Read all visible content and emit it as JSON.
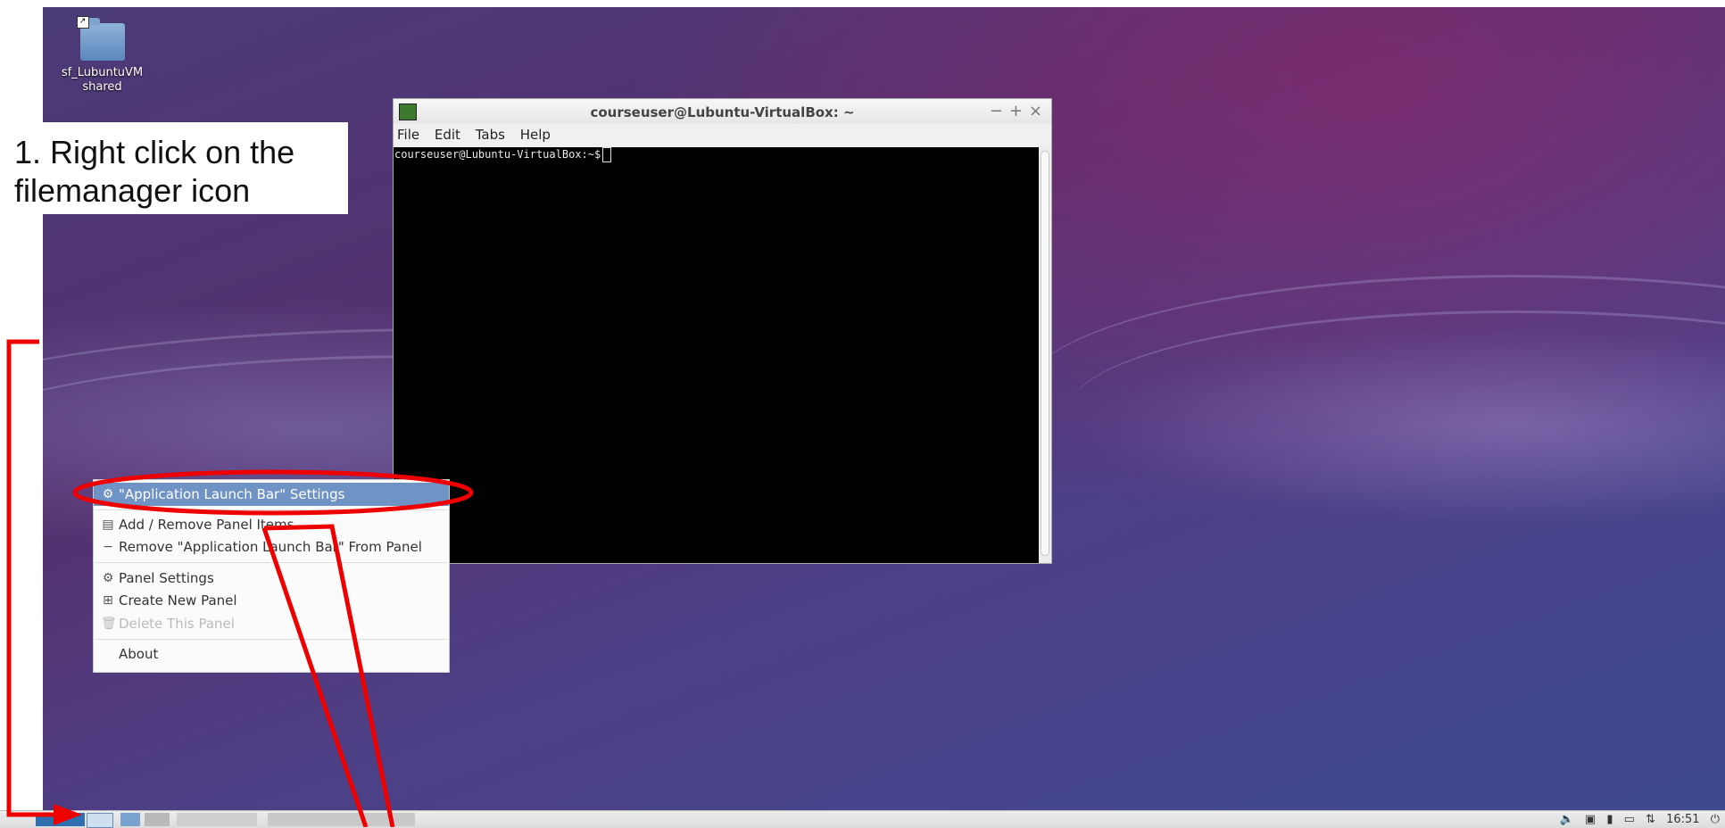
{
  "desktop": {
    "icon_label_line1": "sf_LubuntuVM",
    "icon_label_line2": "shared"
  },
  "annotation": {
    "line1": "1. Right click on the",
    "line2": "filemanager icon"
  },
  "terminal": {
    "title": "courseuser@Lubuntu-VirtualBox: ~",
    "controls": {
      "minimize": "−",
      "maximize": "+",
      "close": "×"
    },
    "menu": [
      "File",
      "Edit",
      "Tabs",
      "Help"
    ],
    "prompt": "courseuser@Lubuntu-VirtualBox:~$"
  },
  "context_menu": {
    "items": [
      {
        "label": "\"Application Launch Bar\" Settings",
        "icon": "gear-icon",
        "highlighted": true,
        "disabled": false
      },
      {
        "label": "Add / Remove Panel Items",
        "icon": "list-icon",
        "highlighted": false,
        "disabled": false
      },
      {
        "label": "Remove \"Application Launch Bar\" From Panel",
        "icon": "minus-icon",
        "highlighted": false,
        "disabled": false
      },
      {
        "label": "Panel Settings",
        "icon": "gear-icon",
        "highlighted": false,
        "disabled": false
      },
      {
        "label": "Create New Panel",
        "icon": "add-icon",
        "highlighted": false,
        "disabled": false
      },
      {
        "label": "Delete This Panel",
        "icon": "trash-icon",
        "highlighted": false,
        "disabled": true
      },
      {
        "label": "About",
        "icon": "",
        "highlighted": false,
        "disabled": false
      }
    ]
  },
  "taskbar": {
    "clock": "16:51"
  },
  "colors": {
    "annotation_red": "#ee0000",
    "menu_highlight": "#6f93c5"
  }
}
